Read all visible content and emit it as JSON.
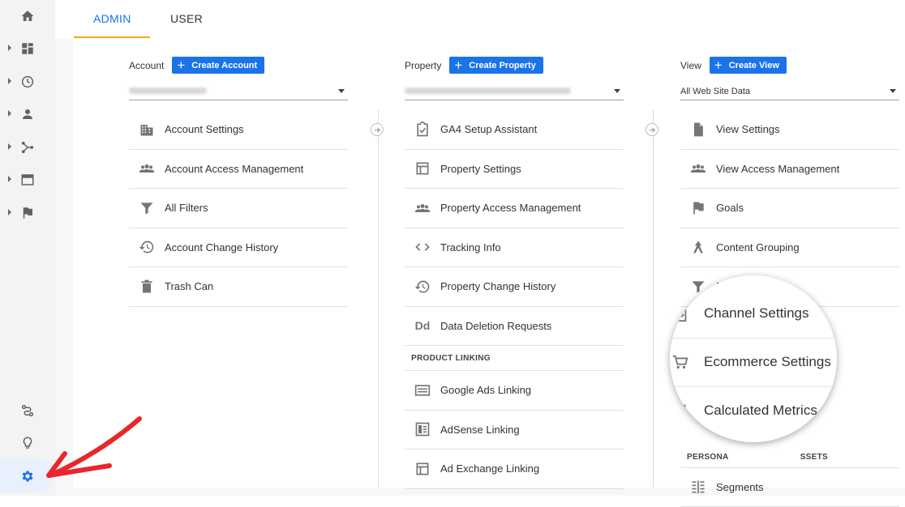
{
  "tabs": {
    "admin": "ADMIN",
    "user": "USER"
  },
  "account": {
    "label": "Account",
    "create": "Create Account",
    "items": [
      "Account Settings",
      "Account Access Management",
      "All Filters",
      "Account Change History",
      "Trash Can"
    ]
  },
  "property": {
    "label": "Property",
    "create": "Create Property",
    "items": [
      "GA4 Setup Assistant",
      "Property Settings",
      "Property Access Management",
      "Tracking Info",
      "Property Change History",
      "Data Deletion Requests"
    ],
    "product_linking": "PRODUCT LINKING",
    "linking_items": [
      "Google Ads Linking",
      "AdSense Linking",
      "Ad Exchange Linking"
    ],
    "dd_glyph": "Dd"
  },
  "view": {
    "label": "View",
    "create": "Create View",
    "selected": "All Web Site Data",
    "items": [
      "View Settings",
      "View Access Management",
      "Goals",
      "Content Grouping"
    ],
    "filters_partial": "Fi",
    "personal_partial_left": "PERSONA",
    "personal_partial_right": "SSETS",
    "segments": "Segments"
  },
  "magnifier": {
    "items": [
      "Channel Settings",
      "Ecommerce Settings",
      "Calculated Metrics"
    ]
  },
  "colors": {
    "accent": "#1a73e8",
    "tab_underline": "#f4a424",
    "annotation": "#e8262c"
  }
}
